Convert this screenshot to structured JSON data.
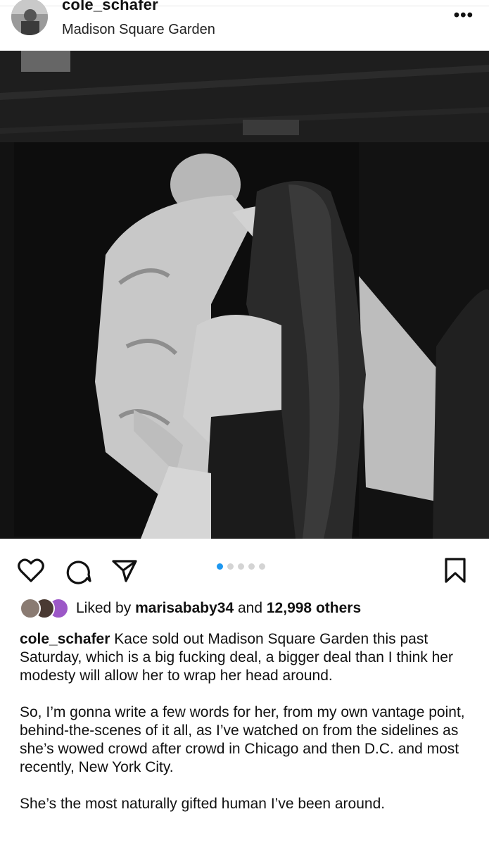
{
  "post": {
    "username": "cole_schafer",
    "location": "Madison Square Garden",
    "more_icon": "more-horizontal-icon"
  },
  "photo": {
    "description_icon": "photo"
  },
  "actions": {
    "like_icon": "heart-icon",
    "comment_icon": "comment-icon",
    "share_icon": "send-icon",
    "save_icon": "bookmark-icon",
    "carousel_total": 5,
    "carousel_active": 1
  },
  "likes": {
    "prefix": "Liked by ",
    "user": "marisababy34",
    "middle": " and ",
    "count": "12,998 others"
  },
  "caption": {
    "author": "cole_schafer",
    "p1": " Kace sold out Madison Square Garden this past Saturday, which is a big fucking deal, a bigger deal than I think her modesty will allow her to wrap her head around.",
    "p2": "So, I’m gonna write a few words for her, from my own vantage point, behind-the-scenes of it all, as I’ve watched on from the sidelines as she’s wowed crowd after crowd in Chicago and then D.C. and most recently, New York City.",
    "p3": "She’s the most naturally gifted human I’ve been around."
  },
  "colors": {
    "accent": "#1d97f0",
    "dot_inactive": "#d4d4d4"
  }
}
